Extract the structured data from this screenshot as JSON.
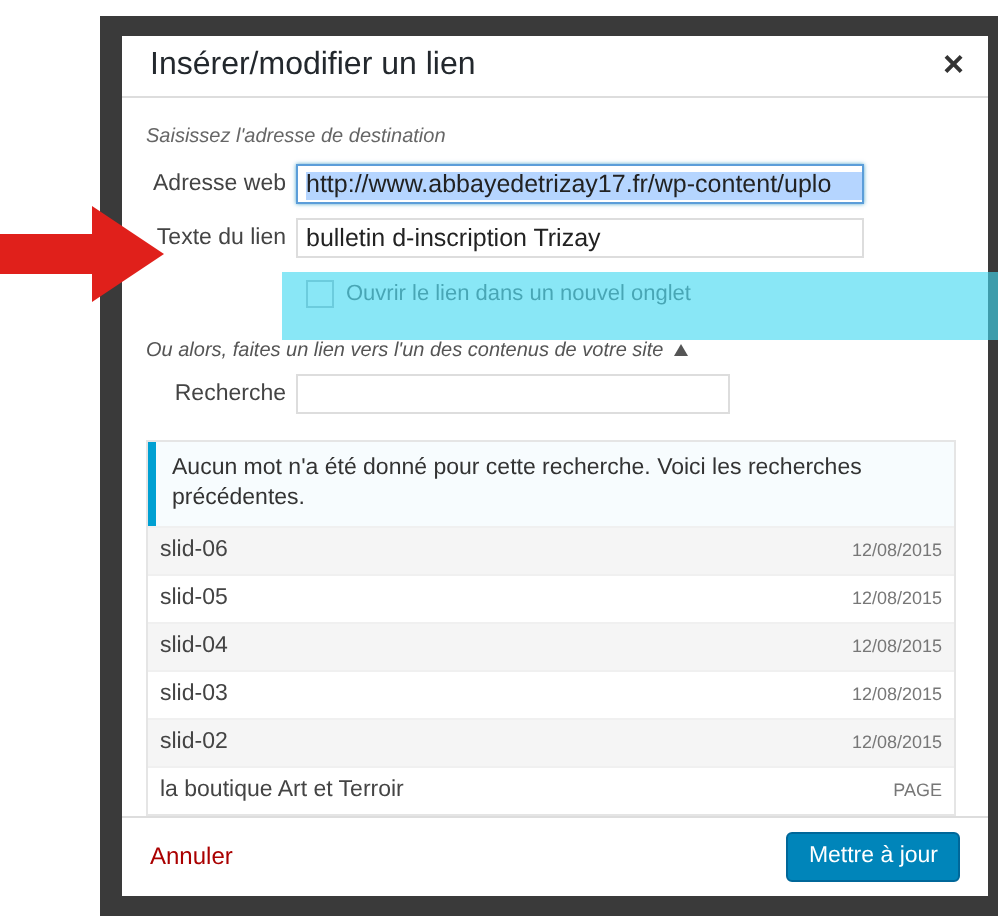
{
  "dialog": {
    "title": "Insérer/modifier un lien",
    "close": "×"
  },
  "destination": {
    "hint": "Saisissez l'adresse de destination",
    "fields": [
      {
        "label": "Adresse web",
        "value": "http://www.abbayedetrizay17.fr/wp-content/uplo",
        "highlighted": true
      },
      {
        "label": "Texte du lien",
        "value": "bulletin d-inscription Trizay",
        "highlighted": false
      }
    ],
    "new_tab": {
      "label": "Ouvrir le lien dans un nouvel onglet",
      "checked": false
    }
  },
  "link_existing": {
    "toggle": "Ou alors, faites un lien vers l'un des contenus de votre site",
    "expanded": true,
    "search": {
      "label": "Recherche"
    },
    "notice": "Aucun mot n'a été donné pour cette recherche. Voici les recherches précédentes.",
    "results": [
      {
        "title": "slid-06",
        "info": "12/08/2015"
      },
      {
        "title": "slid-05",
        "info": "12/08/2015"
      },
      {
        "title": "slid-04",
        "info": "12/08/2015"
      },
      {
        "title": "slid-03",
        "info": "12/08/2015"
      },
      {
        "title": "slid-02",
        "info": "12/08/2015"
      },
      {
        "title": "la boutique Art et Terroir",
        "info": "PAGE"
      }
    ]
  },
  "footer": {
    "cancel": "Annuler",
    "submit": "Mettre à jour"
  }
}
